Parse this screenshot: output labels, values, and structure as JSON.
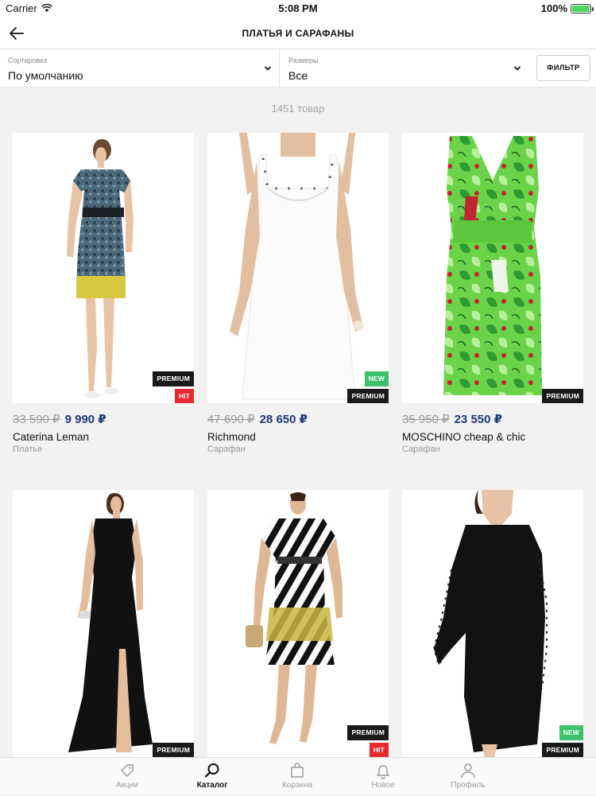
{
  "status_bar": {
    "carrier": "Carrier",
    "time": "5:08 PM",
    "battery": "100%"
  },
  "nav": {
    "title": "ПЛАТЬЯ И САРАФАНЫ"
  },
  "filters": {
    "sort_label": "Сортировка",
    "sort_value": "По умолчанию",
    "size_label": "Размеры",
    "size_value": "Все",
    "filter_button": "ФИЛЬТР"
  },
  "count_text": "1451 товар",
  "products": [
    {
      "old_price": "33 590 ₽",
      "price": "9 990 ₽",
      "brand": "Caterina Leman",
      "type": "Платье",
      "badges": [
        "PREMIUM",
        "HIT"
      ]
    },
    {
      "old_price": "47 690 ₽",
      "price": "28 650 ₽",
      "brand": "Richmond",
      "type": "Сарафан",
      "badges": [
        "NEW",
        "PREMIUM"
      ]
    },
    {
      "old_price": "35 950 ₽",
      "price": "23 550 ₽",
      "brand": "MOSCHINO cheap & chic",
      "type": "Сарафан",
      "badges": [
        "PREMIUM"
      ]
    },
    {
      "badges": [
        "PREMIUM"
      ]
    },
    {
      "badges": [
        "PREMIUM",
        "HIT"
      ]
    },
    {
      "badges": [
        "NEW",
        "PREMIUM"
      ]
    }
  ],
  "tab_bar": [
    {
      "label": "Акции",
      "icon": "tag-icon",
      "active": false
    },
    {
      "label": "Каталог",
      "icon": "search-icon",
      "active": true
    },
    {
      "label": "Корзина",
      "icon": "bag-icon",
      "active": false
    },
    {
      "label": "Новое",
      "icon": "bell-icon",
      "active": false
    },
    {
      "label": "Профиль",
      "icon": "user-icon",
      "active": false
    }
  ],
  "colors": {
    "price": "#1f3a7a",
    "badge_premium": "#1a1a1a",
    "badge_new": "#3bc26a",
    "badge_hit": "#e8282f",
    "battery": "#4cd964"
  }
}
